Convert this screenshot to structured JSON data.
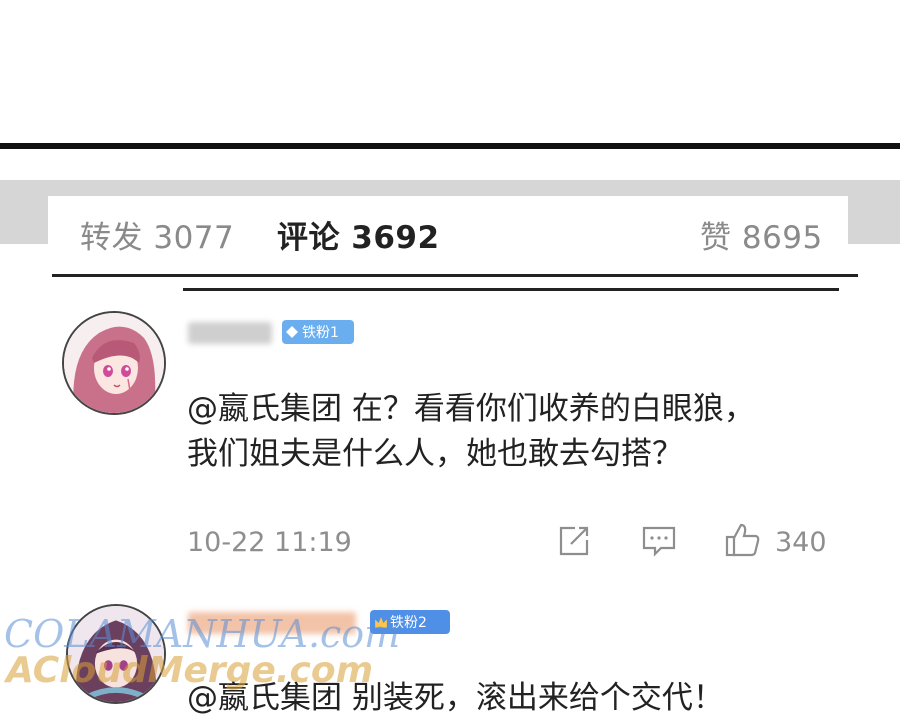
{
  "stats": {
    "repost": "转发 3077",
    "comments": "评论 3692",
    "likes": "赞 8695"
  },
  "comments": [
    {
      "badge": "铁粉1",
      "text_line1": "@嬴氏集团 在？看看你们收养的白眼狼，",
      "text_line2": "我们姐夫是什么人，她也敢去勾搭？",
      "timestamp": "10-22 11:19",
      "like_count": "340",
      "icons": [
        "share-icon",
        "comment-icon",
        "thumbs-up-icon"
      ]
    },
    {
      "badge": "铁粉2",
      "text_line1": "@嬴氏集团 别装死，滚出来给个交代！"
    }
  ],
  "watermarks": {
    "line1": "COLAMANHUA.com",
    "line2": "ACloudMerge.com"
  },
  "colors": {
    "badge_blue": "#6aaef0",
    "badge_blue2": "#4f8fe6",
    "text_dark": "#222222",
    "text_gray": "#8e8e8e",
    "band_gray": "#d6d6d6"
  }
}
